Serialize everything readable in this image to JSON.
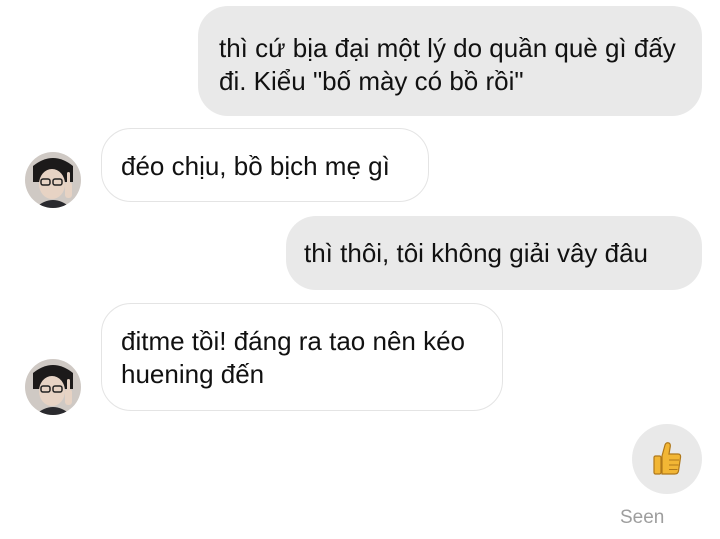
{
  "messages": [
    {
      "direction": "outgoing",
      "text": "thì cứ bịa đại một lý do quần què gì đấy đi. Kiểu \"bố mày có bồ rồi\""
    },
    {
      "direction": "incoming",
      "text": "đéo chịu, bồ bịch mẹ gì"
    },
    {
      "direction": "outgoing",
      "text": "thì thôi, tôi không giải vây đâu"
    },
    {
      "direction": "incoming",
      "text": "đitme tồi! đáng ra tao nên kéo huening đến"
    }
  ],
  "reaction": {
    "icon": "thumbs-up-icon"
  },
  "status": {
    "seen": "Seen"
  },
  "colors": {
    "outgoing_bubble": "#e9e9e9",
    "incoming_bubble": "#ffffff",
    "incoming_border": "#e4e4e4",
    "seen_text": "#9e9e9e",
    "thumb": "#f2b635"
  }
}
